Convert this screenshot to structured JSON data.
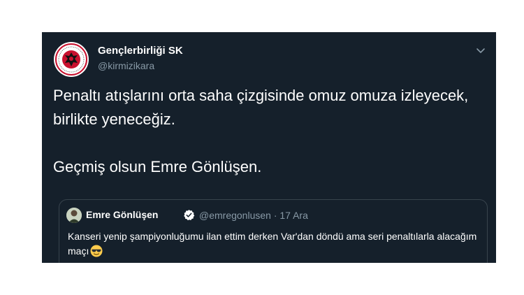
{
  "tweet": {
    "author": {
      "display_name": "Gençlerbirliği SK",
      "handle": "@kirmizikara",
      "avatar_icon": "club-crest-icon"
    },
    "menu_icon": "chevron-down-icon",
    "text_paragraphs": [
      "Penaltı atışlarını orta saha çizgisinde omuz omuza izleyecek, birlikte yeneceğiz.",
      "Geçmiş olsun Emre Gönlüşen."
    ]
  },
  "quoted_tweet": {
    "author": {
      "display_name": "Emre Gönlüşen",
      "handle": "@emregonlusen",
      "date": "17 Ara",
      "verified_icon": "verified-badge-icon",
      "avatar_icon": "user-avatar-icon"
    },
    "text": "Kanseri yenip şampiyonluğumu ilan ettim derken Var'dan döndü ama seri penaltılarla alacağım maçı",
    "emoji_icon": "sunglasses-emoji-icon"
  },
  "colors": {
    "background": "#15202b",
    "text_primary": "#ffffff",
    "text_secondary": "#8899a6",
    "border": "#38444d",
    "verified": "#ffffff",
    "crest_red": "#c8102e"
  }
}
